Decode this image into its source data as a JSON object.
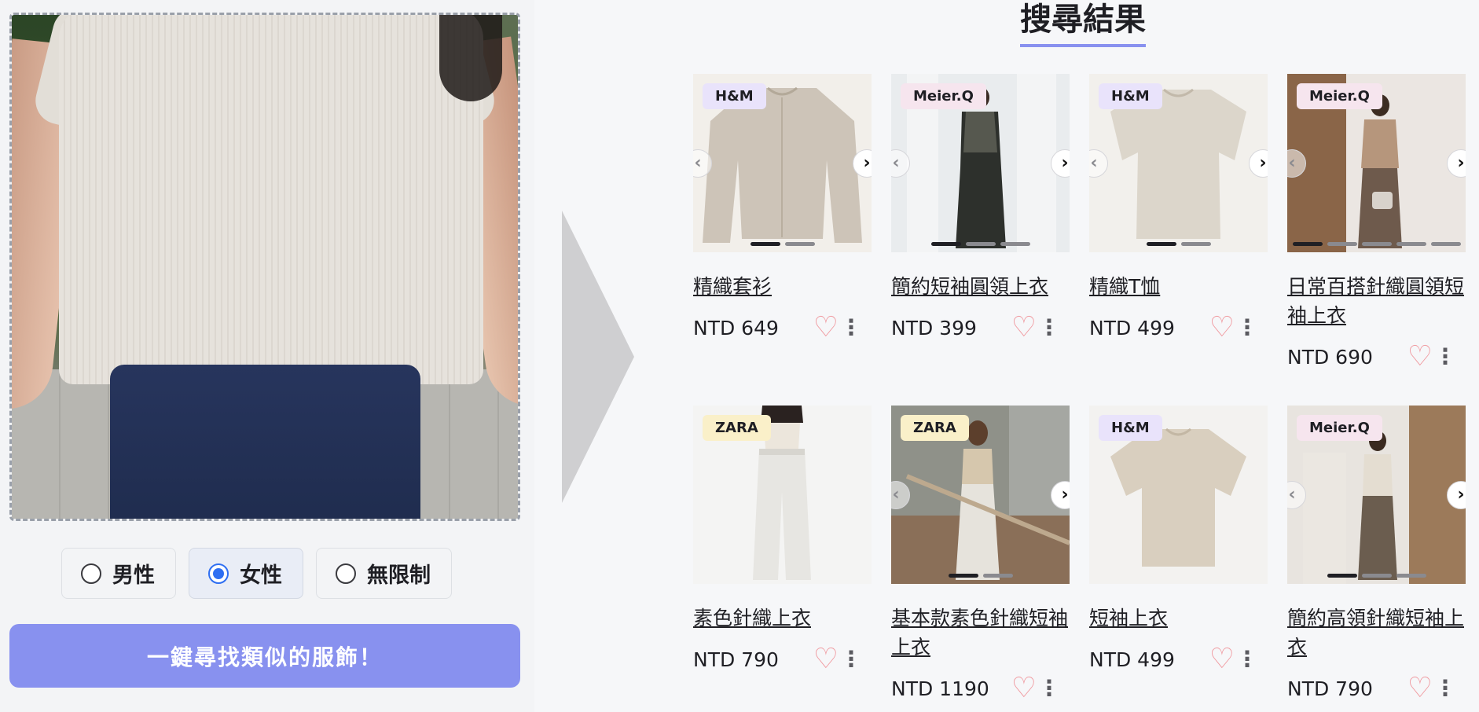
{
  "upload": {
    "photo_alt": "woman wearing a beige ribbed t-shirt and navy jeans"
  },
  "gender": {
    "options": [
      {
        "label": "男性",
        "selected": false
      },
      {
        "label": "女性",
        "selected": true
      },
      {
        "label": "無限制",
        "selected": false
      }
    ]
  },
  "find_button_label": "一鍵尋找類似的服飾！",
  "results": {
    "title": "搜尋結果",
    "nav_prev_glyph": "‹",
    "nav_next_glyph": "›",
    "heart_glyph": "♡",
    "more_glyph": "⋮",
    "products": [
      {
        "brand": "H&M",
        "name": "精織套衫",
        "price": "NTD 649"
      },
      {
        "brand": "Meier.Q",
        "name": "簡約短袖圓領上衣",
        "price": "NTD 399"
      },
      {
        "brand": "H&M",
        "name": "精織T恤",
        "price": "NTD 499"
      },
      {
        "brand": "Meier.Q",
        "name": "日常百搭針織圓領短袖上衣",
        "price": "NTD 690"
      },
      {
        "brand": "ZARA",
        "name": "素色針織上衣",
        "price": "NTD 790"
      },
      {
        "brand": "ZARA",
        "name": "基本款素色針織短袖上衣",
        "price": "NTD 1190"
      },
      {
        "brand": "H&M",
        "name": "短袖上衣",
        "price": "NTD 499"
      },
      {
        "brand": "Meier.Q",
        "name": "簡約高領針織短袖上衣",
        "price": "NTD 790"
      }
    ]
  },
  "colors": {
    "accent": "#8891ef",
    "radio_selected": "#2f6ff2",
    "heart": "#f09aa0",
    "badge_hm": "#e9e3fb",
    "badge_meier": "#f6e5ee",
    "badge_zara": "#faf0c9"
  }
}
